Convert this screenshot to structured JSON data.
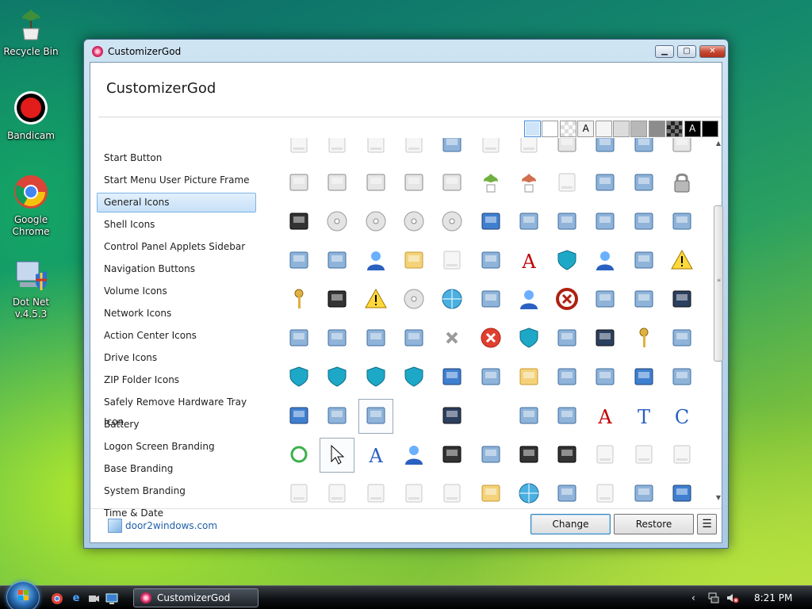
{
  "desktop": {
    "icons": [
      {
        "label": "Recycle Bin",
        "icon": "recycle-bin-icon"
      },
      {
        "label": "Bandicam",
        "icon": "bandicam-icon"
      },
      {
        "label": "Google Chrome",
        "icon": "chrome-icon"
      },
      {
        "label": "Dot Net v.4.5.3",
        "icon": "dotnet-installer-icon"
      }
    ]
  },
  "window": {
    "title": "CustomizerGod",
    "heading": "CustomizerGod",
    "controls": {
      "minimize": "minimize",
      "maximize": "maximize",
      "close": "close"
    }
  },
  "nav": {
    "selected_index": 2,
    "items": [
      "Start Button",
      "Start Menu User Picture Frame",
      "General Icons",
      "Shell Icons",
      "Control Panel Applets Sidebar",
      "Navigation Buttons",
      "Volume Icons",
      "Network Icons",
      "Action Center Icons",
      "Drive Icons",
      "ZIP Folder Icons",
      "Safely Remove Hardware Tray Icon",
      "Battery",
      "Logon Screen Branding",
      "Base Branding",
      "System Branding",
      "Time & Date"
    ]
  },
  "swatches": {
    "selected_index": 0,
    "items": [
      {
        "bg": "#cfe4f8",
        "label": ""
      },
      {
        "bg": "#ffffff",
        "label": ""
      },
      {
        "bg": "checker",
        "label": ""
      },
      {
        "bg": "#f2f2f2",
        "label": "A"
      },
      {
        "bg": "#f4f4f4",
        "label": ""
      },
      {
        "bg": "#dcdcdc",
        "label": ""
      },
      {
        "bg": "#b8b8b8",
        "label": ""
      },
      {
        "bg": "#8c8c8c",
        "label": ""
      },
      {
        "bg": "checker-dark",
        "label": ""
      },
      {
        "bg": "#000000",
        "label": "A"
      },
      {
        "bg": "#000000",
        "label": ""
      }
    ]
  },
  "icon_grid": {
    "focused": [
      [
        7,
        2
      ],
      [
        8,
        1
      ]
    ],
    "rows": [
      [
        "drive-icon",
        "drive-icon",
        "drive-icon",
        "drive-icon",
        "floppy-blue-icon",
        "server-drive-icon",
        "disk-drive-icon",
        "network-printer-icon",
        "camcorder-icon",
        "mobile-phone-icon",
        "printer-check-icon"
      ],
      [
        "printer-check-icon",
        "printer-green-icon",
        "printer-icon",
        "floppy-printer-icon",
        "printer-arrow-icon",
        "plant-icon",
        "plant-red-icon",
        "drive-white-icon",
        "camera-icon",
        "cable-icon",
        "padlock-icon"
      ],
      [
        "media-player-icon",
        "cd-icon",
        "cd-r-icon",
        "cd-rom-icon",
        "cd-rw-icon",
        "book-blue-icon",
        "mp3-player-icon",
        "package-icon",
        "window-settings-icon",
        "system-config-icon",
        "picture-frame-icon"
      ],
      [
        "document-image-icon",
        "document-blue-icon",
        "network-user-icon",
        "folder-network-icon",
        "drive-question-icon",
        "scanner-icon",
        "font-icon",
        "shield-icon",
        "users-icon",
        "computer-icon",
        "warning-icon"
      ],
      [
        "key-icon",
        "film-icon",
        "warning-small-icon",
        "cd-music-icon",
        "globe-icon",
        "window-blue-icon",
        "user-icon",
        "no-entry-icon",
        "document-pen-icon",
        "fax-icon",
        "monitor-icon"
      ],
      [
        "pda-icon",
        "connector-icon",
        "scanner-flat-icon",
        "panel-icon",
        "close-x-icon",
        "error-icon",
        "shield-question-icon",
        "chip-icon",
        "monitor-flat-icon",
        "keyboard-icon",
        "projector-screen-icon"
      ],
      [
        "shield-question-blue-icon",
        "shield-error-icon",
        "shield-check-icon",
        "shield-warning-icon",
        "music-book-icon",
        "quake-icon",
        "folder-dark-icon",
        "blocks-icon",
        "document-stack-icon",
        "binder-icon",
        "server-settings-icon"
      ],
      [
        "star-book-icon",
        "gear-page-icon",
        "clock-settings-icon",
        "",
        "network-monitors-icon",
        "",
        "picture-icon",
        "wallpaper-icon",
        "font-red-icon",
        "font-t-icon",
        "font-c-icon"
      ],
      [
        "circle-green-icon",
        "cursor-icon",
        "font-blue-icon",
        "user-blue-icon",
        "media-black-icon",
        "document-image-small-icon",
        "film-clapper-icon",
        "film-clapper2-icon",
        "drive-icon",
        "drive-icon",
        "drive-icon"
      ],
      [
        "drive-icon",
        "drive-icon",
        "drive-icon",
        "drive-icon",
        "drive-icon",
        "folder-icon",
        "globe-small-icon",
        "hourglass-icon",
        "drive-icon",
        "recycle-icon",
        "book-black-icon"
      ]
    ]
  },
  "footer": {
    "link": "door2windows.com",
    "change_label": "Change",
    "restore_label": "Restore",
    "menu_label": "☰"
  },
  "taskbar": {
    "task_label": "CustomizerGod",
    "clock": "8:21 PM"
  }
}
